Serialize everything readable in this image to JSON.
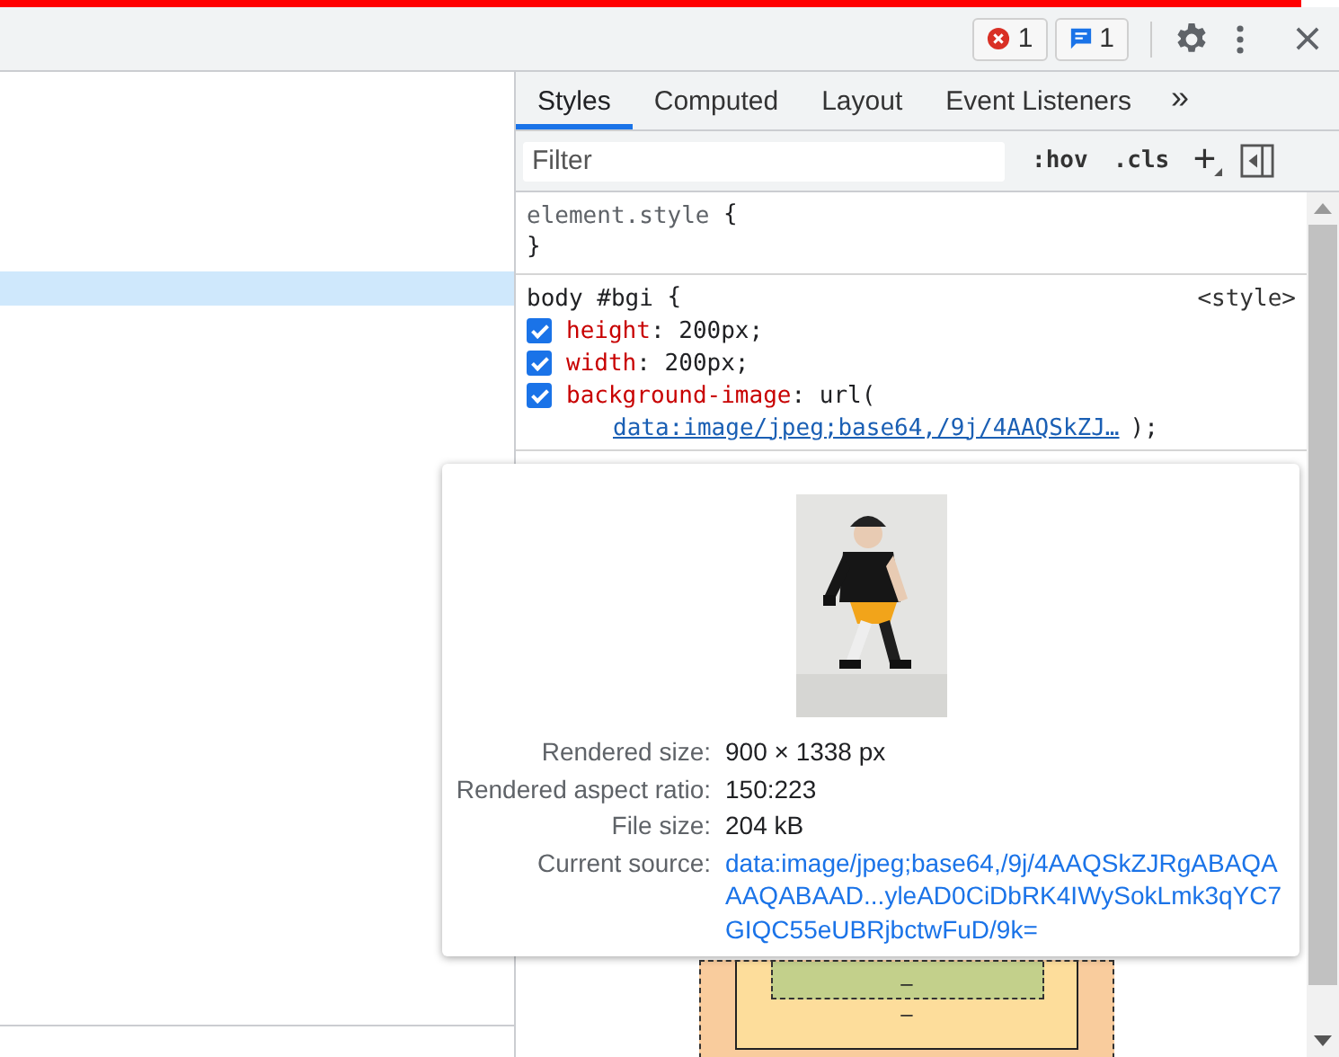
{
  "toolbar": {
    "error_count": "1",
    "message_count": "1"
  },
  "elements_tree": {
    "rows": [
      {
        "selected": false
      },
      {
        "selected": false
      },
      {
        "selected": false
      },
      {
        "selected": false
      },
      {
        "selected": false
      },
      {
        "selected": false
      },
      {
        "selected": true
      }
    ]
  },
  "tabs": [
    {
      "label": "Styles",
      "selected": true
    },
    {
      "label": "Computed",
      "selected": false
    },
    {
      "label": "Layout",
      "selected": false
    },
    {
      "label": "Event Listeners",
      "selected": false
    }
  ],
  "more_tabs": "»",
  "filter": {
    "placeholder": "Filter",
    "hov": ":hov",
    "cls": ".cls"
  },
  "rules": [
    {
      "kind": "inline",
      "selector": "element.style",
      "open": "{",
      "close": "}"
    },
    {
      "kind": "stylesheet",
      "selector": "body #bgi",
      "open": "{",
      "source": "<style>",
      "declarations": [
        {
          "property": "height",
          "value": ": 200px;",
          "checked": true
        },
        {
          "property": "width",
          "value": ": 200px;",
          "checked": true
        },
        {
          "property": "background-image",
          "value": ": url(",
          "link": "data:image/jpeg;base64,/9j/4AAQSkZJ…",
          "value_end": ");",
          "checked": true
        }
      ]
    }
  ],
  "box_model": {
    "border_value": "–",
    "padding_value": "–"
  },
  "image_tooltip": {
    "rows": [
      {
        "label": "Rendered size:",
        "value": "900 × 1338 px",
        "kind": "text"
      },
      {
        "label": "Rendered aspect ratio:",
        "value": "150:223",
        "kind": "text"
      },
      {
        "label": "File size:",
        "value": "204 kB",
        "kind": "text"
      },
      {
        "label": "Current source:",
        "value": "data:image/jpeg;base64,/9j/4AAQSkZJRgABAQAAAQABAAD...yleAD0CiDbRK4IWySokLmk3qYC7GIQC55eUBRjbctwFuD/9k=",
        "kind": "link"
      }
    ]
  }
}
